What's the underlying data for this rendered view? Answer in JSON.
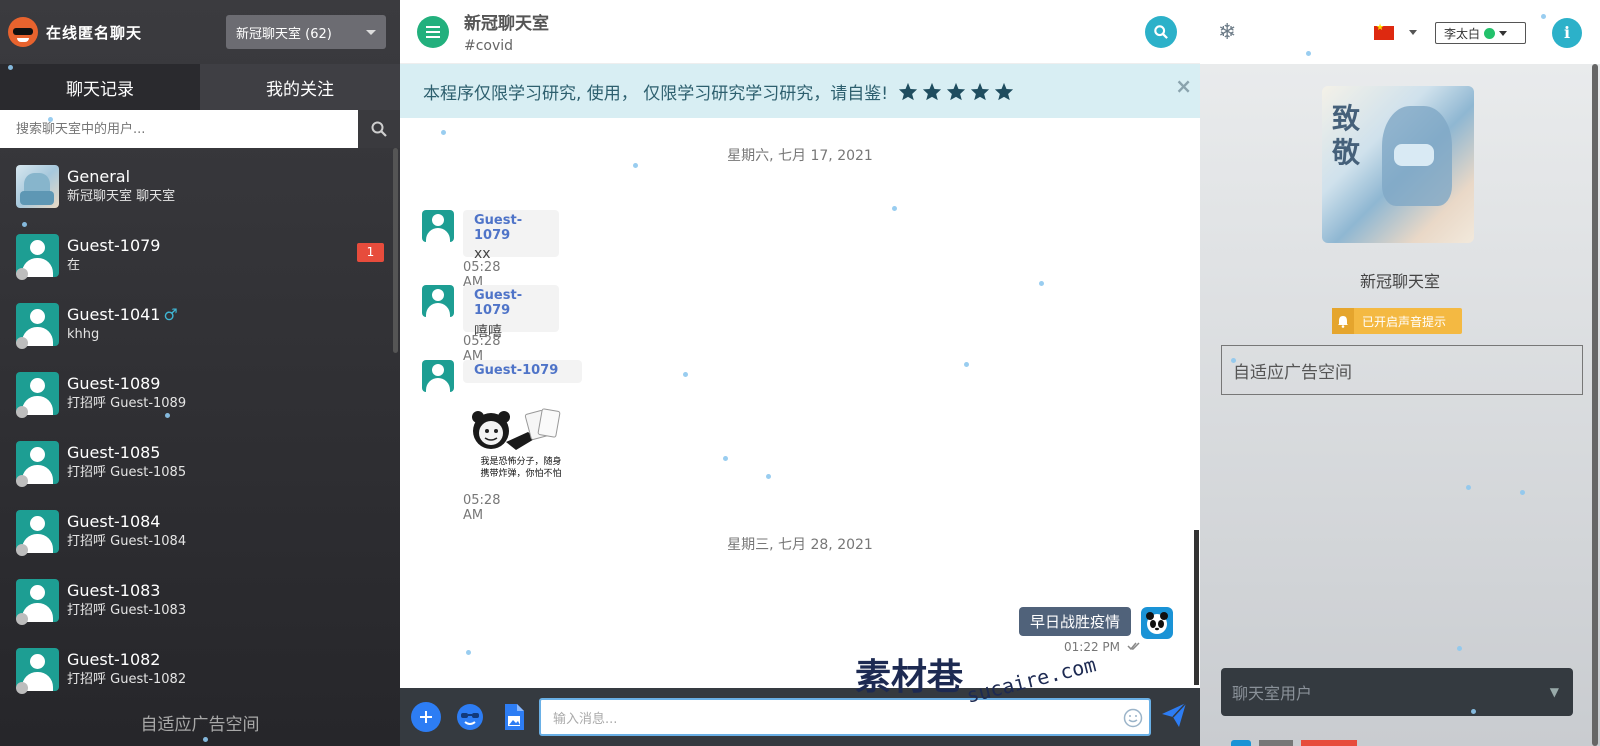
{
  "app": {
    "title": "在线匿名聊天"
  },
  "left": {
    "room_select": "新冠聊天室 (62)",
    "tabs": [
      "聊天记录",
      "我的关注"
    ],
    "search_placeholder": "搜索聊天室中的用户...",
    "chats": [
      {
        "name": "General",
        "last": "新冠聊天室 聊天室",
        "unread": "",
        "male": "",
        "avatar": "general"
      },
      {
        "name": "Guest-1079",
        "last": "在",
        "unread": "1",
        "male": "",
        "avatar": "user"
      },
      {
        "name": "Guest-1041",
        "last": "khhg",
        "unread": "",
        "male": "♂",
        "avatar": "user"
      },
      {
        "name": "Guest-1089",
        "last": "打招呼 Guest-1089",
        "unread": "",
        "male": "",
        "avatar": "user"
      },
      {
        "name": "Guest-1085",
        "last": "打招呼 Guest-1085",
        "unread": "",
        "male": "",
        "avatar": "user"
      },
      {
        "name": "Guest-1084",
        "last": "打招呼 Guest-1084",
        "unread": "",
        "male": "",
        "avatar": "user"
      },
      {
        "name": "Guest-1083",
        "last": "打招呼 Guest-1083",
        "unread": "",
        "male": "",
        "avatar": "user"
      },
      {
        "name": "Guest-1082",
        "last": "打招呼 Guest-1082",
        "unread": "",
        "male": "",
        "avatar": "user"
      }
    ],
    "ad": "自适应广告空间"
  },
  "center": {
    "room_title": "新冠聊天室",
    "room_tag": "#covid",
    "notice": "本程序仅限学习研究, 使用， 仅限学习研究学习研究，请自鉴!",
    "notice_close": "×",
    "date1": "星期六, 七月 17, 2021",
    "date2": "星期三, 七月 28, 2021",
    "messages": [
      {
        "sender": "Guest-1079",
        "text": "xx",
        "time": "05:28 AM"
      },
      {
        "sender": "Guest-1079",
        "text": "嘻嘻",
        "time": "05:28 AM"
      },
      {
        "sender": "Guest-1079",
        "text": "",
        "time": "05:28 AM"
      }
    ],
    "meme_caption_1": "我是恐怖分子，随身",
    "meme_caption_2": "携带炸弹，你怕不怕",
    "own_message": {
      "text": "早日战胜疫情",
      "time": "01:22 PM"
    },
    "composer_placeholder": "输入消息...",
    "watermark_cn": "素材巷",
    "watermark_en": "sucaire.com"
  },
  "right": {
    "user_name": "李太白",
    "poster_text": "致敬",
    "room_name": "新冠聊天室",
    "sound_badge": "已开启声音提示",
    "ad": "自适应广告空间",
    "users_select": "聊天室用户",
    "info_label": "i"
  },
  "colors": {
    "left_bg": "#2f2f33",
    "accent_teal": "#1d9e93",
    "accent_cyan": "#2cb1c9",
    "notice_bg": "#d8eef3",
    "unread_red": "#e74c3c",
    "badge_yellow": "#f4b942",
    "own_bubble": "#50627a",
    "composer_bg": "#353a40"
  }
}
